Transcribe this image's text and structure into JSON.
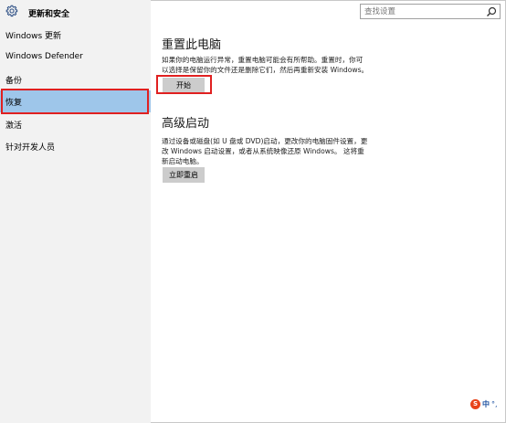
{
  "header": {
    "title": "更新和安全",
    "icon": "gear-icon"
  },
  "search": {
    "placeholder": "查找设置",
    "icon": "search-icon"
  },
  "sidebar": {
    "items": [
      {
        "label": "Windows 更新"
      },
      {
        "label": "Windows Defender"
      },
      {
        "label": "备份"
      },
      {
        "label": "恢复",
        "selected": true
      },
      {
        "label": "激活"
      },
      {
        "label": "针对开发人员"
      }
    ]
  },
  "reset": {
    "title": "重置此电脑",
    "line1": "如果你的电脑运行异常，重置电脑可能会有所帮助。重置时，你可",
    "line2": "以选择是保留你的文件还是删除它们，然后再重新安装 Windows。",
    "button": "开始"
  },
  "advanced": {
    "title": "高级启动",
    "line1": "通过设备或磁盘(如 U 盘或 DVD)启动，更改你的电脑固件设置，更",
    "line2": "改 Windows 启动设置，或者从系统映像还原 Windows。 这将重",
    "line3": "新启动电脑。",
    "button": "立即重启"
  },
  "ime": {
    "logo": "S",
    "lang": "中",
    "punct": "°,"
  },
  "colors": {
    "selected": "#9ec6ea",
    "highlight": "#e02020",
    "sidebar_bg": "#f2f2f2",
    "button_bg": "#cccccc"
  }
}
